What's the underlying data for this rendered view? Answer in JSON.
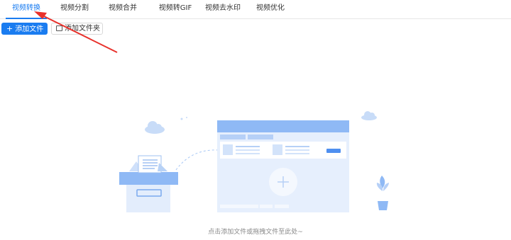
{
  "tabs": [
    {
      "label": "视频转换",
      "active": true
    },
    {
      "label": "视频分割",
      "active": false
    },
    {
      "label": "视频合并",
      "active": false
    },
    {
      "label": "视频转GIF",
      "active": false
    },
    {
      "label": "视频去水印",
      "active": false
    },
    {
      "label": "视频优化",
      "active": false
    }
  ],
  "toolbar": {
    "add_file_label": "添加文件",
    "add_folder_label": "添加文件夹"
  },
  "drop_zone": {
    "hint": "点击添加文件或拖拽文件至此处~"
  },
  "colors": {
    "accent": "#1a7cf0",
    "annotation_arrow": "#e8312b",
    "illustration_blue": "#8fb9f5"
  },
  "icons": [
    "plus-icon",
    "folder-icon",
    "add-circle-icon",
    "cloud-icon",
    "plant-icon",
    "file-box-icon"
  ]
}
